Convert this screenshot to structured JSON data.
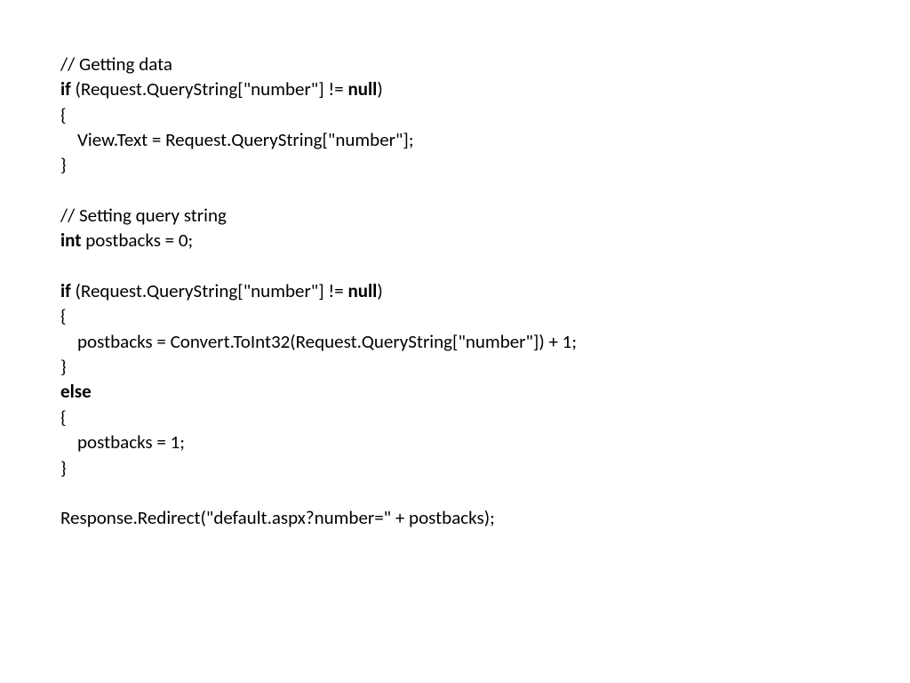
{
  "code": {
    "l1_comment": "// Getting data",
    "l2_if": "if",
    "l2_cond_a": " (Request.QueryString[\"number\"] != ",
    "l2_null": "null",
    "l2_cond_b": ")",
    "l3_brace": "{",
    "l4_body": "    View.Text = Request.QueryString[\"number\"];",
    "l5_brace": "}",
    "l6_blank": " ",
    "l7_comment": "// Setting query string",
    "l8_int": "int",
    "l8_rest": " postbacks = 0;",
    "l9_blank": " ",
    "l10_if": "if",
    "l10_cond_a": " (Request.QueryString[\"number\"] != ",
    "l10_null": "null",
    "l10_cond_b": ")",
    "l11_brace": "{",
    "l12_body": "    postbacks = Convert.ToInt32(Request.QueryString[\"number\"]) + 1;",
    "l13_brace": "}",
    "l14_else": "else",
    "l15_brace": "{",
    "l16_body": "    postbacks = 1;",
    "l17_brace": "}",
    "l18_blank": " ",
    "l19_redirect": "Response.Redirect(\"default.aspx?number=\" + postbacks);"
  }
}
